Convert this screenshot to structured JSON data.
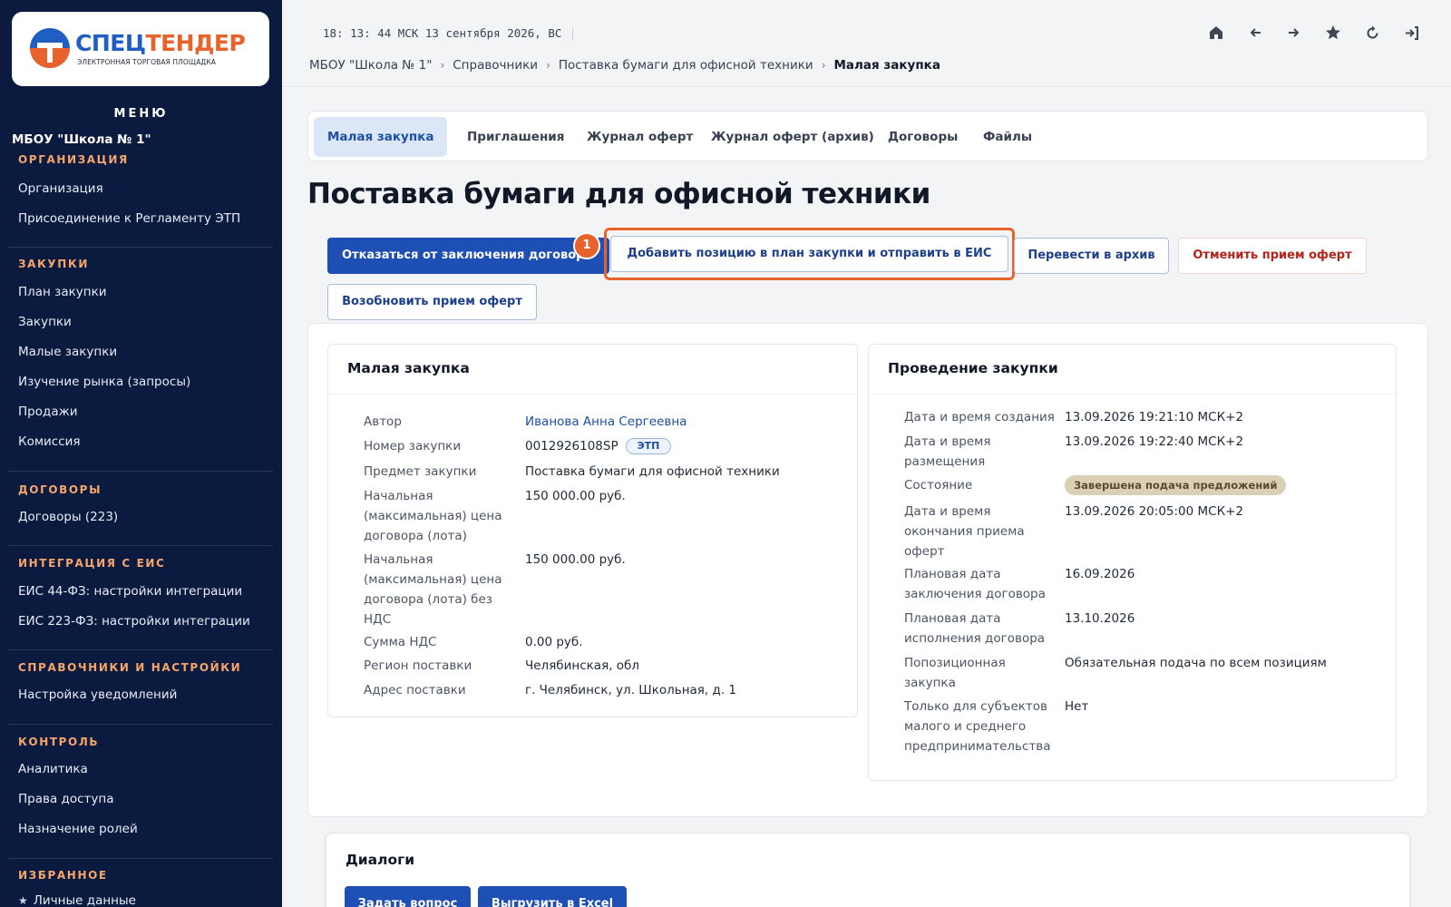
{
  "logo": {
    "part1": "СПЕЦ",
    "part2": "ТЕНДЕР",
    "subtitle": "ЭЛЕКТРОННАЯ ТОРГОВАЯ ПЛОЩАДКА"
  },
  "sidebar": {
    "menu_label": "МЕНЮ",
    "org_name": "МБОУ \"Школа № 1\"",
    "sections": [
      {
        "title": "ОРГАНИЗАЦИЯ",
        "items": [
          "Организация",
          "Присоединение к Регламенту ЭТП"
        ]
      },
      {
        "title": "ЗАКУПКИ",
        "items": [
          "План закупки",
          "Закупки",
          "Малые закупки",
          "Изучение рынка (запросы)",
          "Продажи",
          "Комиссия"
        ]
      },
      {
        "title": "ДОГОВОРЫ",
        "items": [
          "Договоры (223)"
        ]
      },
      {
        "title": "ИНТЕГРАЦИЯ С ЕИС",
        "items": [
          "ЕИС 44-ФЗ: настройки интеграции",
          "ЕИС 223-ФЗ: настройки интеграции"
        ]
      },
      {
        "title": "СПРАВОЧНИКИ И НАСТРОЙКИ",
        "items": [
          "Настройка уведомлений"
        ]
      },
      {
        "title": "КОНТРОЛЬ",
        "items": [
          "Аналитика",
          "Права доступа",
          "Назначение ролей"
        ]
      },
      {
        "title": "ИЗБРАННОЕ",
        "items": [
          "Личные данные"
        ]
      }
    ]
  },
  "topbar": {
    "clock": "18: 13: 44 МСК  13 сентября 2026, ВС",
    "icons": [
      "home-icon",
      "arrow-left-icon",
      "arrow-right-icon",
      "star-icon",
      "refresh-icon",
      "logout-icon"
    ]
  },
  "breadcrumb": [
    "МБОУ \"Школа № 1\"",
    "Справочники",
    "Поставка бумаги для офисной техники",
    "Малая закупка"
  ],
  "tabs": [
    "Малая закупка",
    "Приглашения",
    "Журнал оферт",
    "Журнал оферт (архив)",
    "Договоры",
    "Файлы"
  ],
  "page_title": "Поставка бумаги для офисной техники",
  "actions": {
    "refuse": "Отказаться от заключения договора",
    "add_position": "Добавить позицию в план закупки и отправить в ЕИС",
    "archive": "Перевести в архив",
    "cancel_offers": "Отменить прием оферт",
    "resume_offers": "Возобновить прием оферт",
    "step_badge": "1"
  },
  "purchase_panel": {
    "title": "Малая закупка",
    "rows": [
      {
        "label": "Автор",
        "value": "Иванова Анна Сергеевна"
      },
      {
        "label": "Номер закупки",
        "value": "0012926108SP",
        "tag": "ЭТП"
      },
      {
        "label": "Предмет закупки",
        "value": "Поставка бумаги для офисной техники"
      },
      {
        "label": "Начальная (максимальная) цена договора (лота)",
        "value": "150 000.00 руб."
      },
      {
        "label": "Начальная (максимальная) цена договора (лота) без НДС",
        "value": "150 000.00 руб."
      },
      {
        "label": "Сумма НДС",
        "value": "0.00 руб."
      },
      {
        "label": "Регион поставки",
        "value": "Челябинская, обл"
      },
      {
        "label": "Адрес поставки",
        "value": "г. Челябинск, ул. Школьная, д. 1"
      }
    ]
  },
  "conduct_panel": {
    "title": "Проведение закупки",
    "rows": [
      {
        "label": "Дата и время создания",
        "value": "13.09.2026 19:21:10 МСК+2"
      },
      {
        "label": "Дата и время размещения",
        "value": "13.09.2026 19:22:40 МСК+2"
      },
      {
        "label": "Состояние",
        "value": "Завершена подача предложений"
      },
      {
        "label": "Дата и время окончания приема оферт",
        "value": "13.09.2026 20:05:00 МСК+2"
      },
      {
        "label": "Плановая дата заключения договора",
        "value": "16.09.2026"
      },
      {
        "label": "Плановая дата исполнения договора",
        "value": "13.10.2026"
      },
      {
        "label": "Попозиционная закупка",
        "value": "Обязательная подача по всем позициям"
      },
      {
        "label": "Только для субъектов малого и среднего предпринимательства",
        "value": "Нет"
      }
    ]
  },
  "dialogs": {
    "title": "Диалоги",
    "ask": "Задать вопрос",
    "export": "Выгрузить в Excel"
  },
  "colors": {
    "sidebar_bg": "#0b1a3f",
    "accent": "#1e4fb5",
    "brand_orange": "#e8632b",
    "section_title": "#f6a56a"
  }
}
